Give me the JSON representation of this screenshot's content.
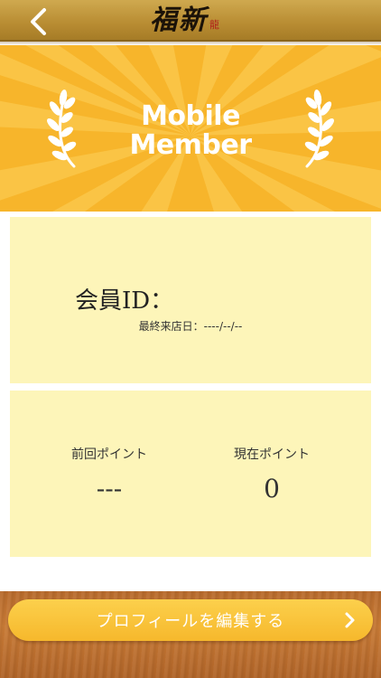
{
  "header": {
    "logo_text": "福新",
    "logo_seal": "龍",
    "back_icon": "chevron-left-icon"
  },
  "banner": {
    "title_line1": "Mobile",
    "title_line2": "Member",
    "background_color": "#f7b52b",
    "laurel_icon": "laurel-icon"
  },
  "member": {
    "id_label": "会員ID：",
    "last_visit_label": "最終来店日：",
    "last_visit_value": "----/--/--"
  },
  "points": {
    "previous_label": "前回ポイント",
    "previous_value": "---",
    "current_label": "現在ポイント",
    "current_value": "0"
  },
  "footer": {
    "edit_profile_label": "プロフィールを編集する",
    "chevron_icon": "chevron-right-icon"
  },
  "colors": {
    "accent": "#f7b52b",
    "card": "#fdf5b9",
    "button": "#f9c33c"
  }
}
